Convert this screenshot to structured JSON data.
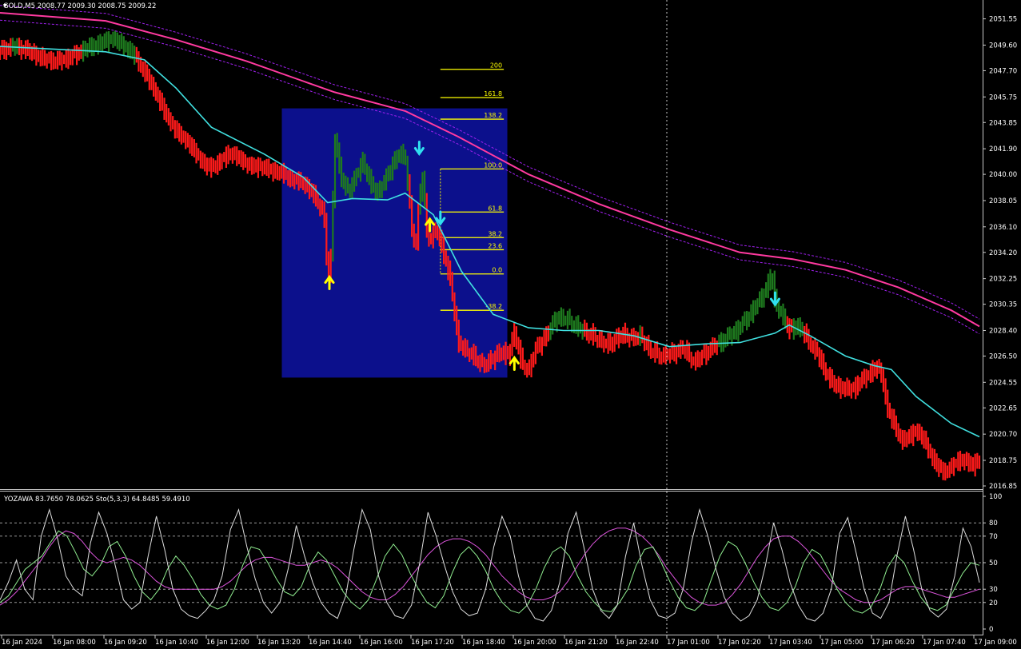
{
  "chart_title": "GOLD,M5  2008.77 2009.30 2008.75 2009.22",
  "indicator_title": "YOZAWA 83.7650 78.0625  Sto(5,3,3) 64.8485 59.4910",
  "colors": {
    "background": "#000000",
    "bull_bar": "#1e7a1e",
    "bear_bar": "#ff1a1a",
    "ma_fast": "#40e0e0",
    "ma_slow": "#ff3aa0",
    "envelope": "#a020f0",
    "fib_box": "#0c108c",
    "fib_line": "#ffff00",
    "arrow_up": "#ffff00",
    "arrow_down": "#30e0f0",
    "stoch_main": "#dddddd",
    "stoch_signal1": "#90ee90",
    "stoch_signal2": "#dd55dd"
  },
  "chart_data": [
    {
      "type": "candlestick",
      "symbol": "GOLD",
      "timeframe": "M5",
      "ohlc_last": {
        "open": 2008.77,
        "high": 2009.3,
        "low": 2008.75,
        "close": 2009.22
      },
      "ylim": [
        2016.85,
        2052.0
      ],
      "y_ticks": [
        "2051.55",
        "2049.60",
        "2047.70",
        "2045.75",
        "2043.85",
        "2041.90",
        "2040.00",
        "2038.05",
        "2036.10",
        "2034.20",
        "2032.25",
        "2030.35",
        "2028.40",
        "2026.50",
        "2024.55",
        "2022.65",
        "2020.70",
        "2018.75",
        "2016.85"
      ],
      "x_ticks": [
        "16 Jan 2024",
        "16 Jan 08:00",
        "16 Jan 09:20",
        "16 Jan 10:40",
        "16 Jan 12:00",
        "16 Jan 13:20",
        "16 Jan 14:40",
        "16 Jan 16:00",
        "16 Jan 17:20",
        "16 Jan 18:40",
        "16 Jan 20:00",
        "16 Jan 21:20",
        "16 Jan 22:40",
        "17 Jan 01:00",
        "17 Jan 02:20",
        "17 Jan 03:40",
        "17 Jan 05:00",
        "17 Jan 06:20",
        "17 Jan 07:40",
        "17 Jan 09:00"
      ],
      "close_path": [
        [
          0,
          2049.2
        ],
        [
          8,
          2049.5
        ],
        [
          16,
          2049.2
        ],
        [
          24,
          2048.6
        ],
        [
          32,
          2048.4
        ],
        [
          40,
          2048.7
        ],
        [
          48,
          2049.3
        ],
        [
          56,
          2049.7
        ],
        [
          64,
          2050.1
        ],
        [
          70,
          2049.6
        ],
        [
          76,
          2048.9
        ],
        [
          82,
          2047.6
        ],
        [
          88,
          2046.2
        ],
        [
          94,
          2044.5
        ],
        [
          100,
          2043.2
        ],
        [
          106,
          2042.5
        ],
        [
          112,
          2041.4
        ],
        [
          118,
          2040.5
        ],
        [
          124,
          2040.8
        ],
        [
          130,
          2041.6
        ],
        [
          136,
          2041.2
        ],
        [
          142,
          2040.6
        ],
        [
          148,
          2040.6
        ],
        [
          154,
          2040.3
        ],
        [
          160,
          2040.1
        ],
        [
          166,
          2039.6
        ],
        [
          172,
          2039.4
        ],
        [
          178,
          2038.5
        ],
        [
          184,
          2037.0
        ],
        [
          186,
          2032.1
        ],
        [
          188,
          2034.0
        ],
        [
          190,
          2042.8
        ],
        [
          194,
          2039.5
        ],
        [
          198,
          2038.8
        ],
        [
          202,
          2039.8
        ],
        [
          206,
          2041.0
        ],
        [
          210,
          2039.4
        ],
        [
          214,
          2038.6
        ],
        [
          218,
          2039.4
        ],
        [
          222,
          2040.5
        ],
        [
          226,
          2041.5
        ],
        [
          230,
          2041.3
        ],
        [
          232,
          2038.6
        ],
        [
          234,
          2035.7
        ],
        [
          236,
          2034.5
        ],
        [
          238,
          2038.2
        ],
        [
          240,
          2040.0
        ],
        [
          242,
          2036.0
        ],
        [
          244,
          2035.0
        ],
        [
          248,
          2036.0
        ],
        [
          252,
          2034.0
        ],
        [
          256,
          2032.0
        ],
        [
          260,
          2027.5
        ],
        [
          264,
          2027.0
        ],
        [
          268,
          2026.6
        ],
        [
          272,
          2026.0
        ],
        [
          276,
          2025.9
        ],
        [
          280,
          2026.3
        ],
        [
          284,
          2026.9
        ],
        [
          288,
          2026.4
        ],
        [
          292,
          2028.3
        ],
        [
          296,
          2026.0
        ],
        [
          300,
          2025.4
        ],
        [
          304,
          2027.0
        ],
        [
          310,
          2028.0
        ],
        [
          316,
          2029.4
        ],
        [
          322,
          2029.2
        ],
        [
          328,
          2028.6
        ],
        [
          334,
          2028.2
        ],
        [
          340,
          2027.7
        ],
        [
          346,
          2027.3
        ],
        [
          352,
          2028.1
        ],
        [
          358,
          2027.9
        ],
        [
          364,
          2027.9
        ],
        [
          370,
          2026.8
        ],
        [
          376,
          2026.5
        ],
        [
          382,
          2026.7
        ],
        [
          388,
          2027.1
        ],
        [
          394,
          2026.0
        ],
        [
          400,
          2026.7
        ],
        [
          406,
          2027.3
        ],
        [
          412,
          2027.8
        ],
        [
          418,
          2028.4
        ],
        [
          424,
          2029.3
        ],
        [
          430,
          2030.4
        ],
        [
          434,
          2031.2
        ],
        [
          438,
          2032.6
        ],
        [
          440,
          2030.4
        ],
        [
          444,
          2029.6
        ],
        [
          448,
          2028.4
        ],
        [
          452,
          2028.8
        ],
        [
          456,
          2028.3
        ],
        [
          460,
          2027.4
        ],
        [
          464,
          2026.7
        ],
        [
          468,
          2025.5
        ],
        [
          472,
          2024.6
        ],
        [
          476,
          2024.2
        ],
        [
          480,
          2024.1
        ],
        [
          484,
          2024.0
        ],
        [
          488,
          2024.6
        ],
        [
          492,
          2025.0
        ],
        [
          496,
          2025.6
        ],
        [
          500,
          2025.4
        ],
        [
          504,
          2022.5
        ],
        [
          508,
          2021.3
        ],
        [
          512,
          2020.2
        ],
        [
          516,
          2020.5
        ],
        [
          520,
          2021.0
        ],
        [
          524,
          2020.4
        ],
        [
          528,
          2019.3
        ],
        [
          532,
          2018.3
        ],
        [
          536,
          2017.9
        ],
        [
          540,
          2018.2
        ],
        [
          544,
          2018.8
        ],
        [
          548,
          2018.7
        ],
        [
          552,
          2018.4
        ],
        [
          556,
          2018.8
        ]
      ],
      "moving_average_fast": [
        [
          0,
          2049.5
        ],
        [
          60,
          2049.1
        ],
        [
          82,
          2048.5
        ],
        [
          100,
          2046.4
        ],
        [
          120,
          2043.5
        ],
        [
          150,
          2041.5
        ],
        [
          172,
          2039.8
        ],
        [
          186,
          2037.9
        ],
        [
          200,
          2038.2
        ],
        [
          220,
          2038.1
        ],
        [
          230,
          2038.6
        ],
        [
          246,
          2037.0
        ],
        [
          262,
          2032.8
        ],
        [
          280,
          2029.6
        ],
        [
          300,
          2028.6
        ],
        [
          320,
          2028.4
        ],
        [
          340,
          2028.4
        ],
        [
          360,
          2028.0
        ],
        [
          380,
          2027.2
        ],
        [
          400,
          2027.4
        ],
        [
          420,
          2027.5
        ],
        [
          440,
          2028.2
        ],
        [
          448,
          2028.8
        ],
        [
          460,
          2028.0
        ],
        [
          480,
          2026.5
        ],
        [
          496,
          2025.8
        ],
        [
          506,
          2025.5
        ],
        [
          520,
          2023.5
        ],
        [
          540,
          2021.5
        ],
        [
          556,
          2020.5
        ]
      ],
      "moving_average_slow": [
        [
          0,
          2052.0
        ],
        [
          60,
          2051.4
        ],
        [
          100,
          2050.0
        ],
        [
          140,
          2048.4
        ],
        [
          190,
          2046.1
        ],
        [
          230,
          2044.7
        ],
        [
          260,
          2042.8
        ],
        [
          300,
          2040.0
        ],
        [
          340,
          2037.8
        ],
        [
          380,
          2035.9
        ],
        [
          420,
          2034.2
        ],
        [
          450,
          2033.7
        ],
        [
          480,
          2032.9
        ],
        [
          510,
          2031.6
        ],
        [
          540,
          2029.9
        ],
        [
          556,
          2028.7
        ]
      ],
      "fibonacci": {
        "levels": [
          "200",
          "161.8",
          "138.2",
          "100.0",
          "61.8",
          "38.2",
          "23.6",
          "0.0",
          "-38.2"
        ],
        "prices": [
          2047.8,
          2045.7,
          2044.1,
          2040.4,
          2037.2,
          2035.3,
          2034.4,
          2032.6,
          2029.9
        ]
      },
      "signals": [
        {
          "type": "buy",
          "x": 187,
          "price": 2032.2
        },
        {
          "type": "sell",
          "x": 238,
          "price": 2041.7
        },
        {
          "type": "buy",
          "x": 244,
          "price": 2036.5
        },
        {
          "type": "sell",
          "x": 250,
          "price": 2036.5
        },
        {
          "type": "buy",
          "x": 292,
          "price": 2026.2
        },
        {
          "type": "sell",
          "x": 440,
          "price": 2030.5
        }
      ]
    },
    {
      "type": "line",
      "name": "YOZAWA / Stochastic",
      "ylim": [
        0,
        100
      ],
      "y_ticks": [
        "100",
        "80",
        "70",
        "50",
        "30",
        "20",
        "0"
      ],
      "levels": [
        80,
        70,
        50,
        30,
        20
      ],
      "series": [
        {
          "name": "Sto main",
          "values": [
            22,
            35,
            52,
            30,
            22,
            70,
            90,
            68,
            40,
            30,
            25,
            65,
            88,
            72,
            48,
            22,
            15,
            20,
            55,
            85,
            60,
            30,
            15,
            10,
            8,
            14,
            22,
            40,
            75,
            90,
            62,
            38,
            20,
            12,
            20,
            45,
            78,
            55,
            35,
            20,
            12,
            8,
            25,
            60,
            90,
            75,
            40,
            20,
            10,
            8,
            18,
            50,
            88,
            70,
            48,
            28,
            15,
            10,
            12,
            30,
            62,
            85,
            70,
            40,
            18,
            8,
            6,
            14,
            35,
            72,
            88,
            60,
            30,
            14,
            8,
            18,
            55,
            80,
            48,
            22,
            10,
            8,
            12,
            30,
            65,
            90,
            70,
            45,
            24,
            12,
            6,
            10,
            22,
            48,
            80,
            60,
            35,
            18,
            8,
            6,
            12,
            30,
            72,
            84,
            58,
            30,
            12,
            8,
            20,
            56,
            85,
            60,
            30,
            14,
            9,
            15,
            40,
            76,
            62,
            35
          ]
        },
        {
          "name": "Sto signal",
          "values": [
            20,
            25,
            35,
            45,
            50,
            55,
            65,
            74,
            70,
            58,
            45,
            40,
            48,
            62,
            66,
            55,
            40,
            28,
            22,
            30,
            45,
            55,
            48,
            38,
            26,
            18,
            15,
            18,
            30,
            48,
            62,
            60,
            50,
            38,
            28,
            25,
            32,
            48,
            58,
            52,
            40,
            28,
            20,
            15,
            22,
            38,
            55,
            64,
            56,
            42,
            30,
            20,
            16,
            25,
            42,
            56,
            62,
            55,
            44,
            30,
            20,
            14,
            12,
            18,
            30,
            46,
            58,
            62,
            55,
            40,
            28,
            20,
            14,
            13,
            20,
            30,
            48,
            60,
            62,
            50,
            36,
            24,
            16,
            14,
            20,
            38,
            55,
            66,
            62,
            50,
            36,
            24,
            16,
            14,
            20,
            32,
            50,
            60,
            56,
            44,
            30,
            20,
            14,
            12,
            16,
            28,
            46,
            56,
            50,
            36,
            24,
            16,
            14,
            18,
            30,
            42,
            50,
            48
          ]
        },
        {
          "name": "YOZAWA",
          "values": [
            18,
            22,
            28,
            36,
            44,
            52,
            62,
            70,
            74,
            72,
            66,
            58,
            52,
            50,
            52,
            54,
            52,
            48,
            42,
            36,
            32,
            30,
            30,
            30,
            30,
            30,
            30,
            32,
            36,
            42,
            48,
            52,
            54,
            54,
            52,
            50,
            48,
            48,
            50,
            52,
            50,
            46,
            40,
            34,
            28,
            24,
            22,
            22,
            26,
            32,
            40,
            48,
            56,
            62,
            66,
            68,
            68,
            66,
            62,
            56,
            48,
            40,
            34,
            28,
            24,
            22,
            22,
            24,
            28,
            36,
            46,
            56,
            64,
            70,
            74,
            76,
            76,
            74,
            70,
            64,
            56,
            46,
            38,
            30,
            24,
            20,
            18,
            18,
            20,
            26,
            34,
            44,
            54,
            62,
            68,
            70,
            70,
            66,
            60,
            52,
            44,
            36,
            30,
            26,
            22,
            20,
            20,
            22,
            26,
            30,
            32,
            32,
            30,
            28,
            26,
            24,
            24,
            26,
            28,
            30
          ]
        }
      ]
    }
  ]
}
